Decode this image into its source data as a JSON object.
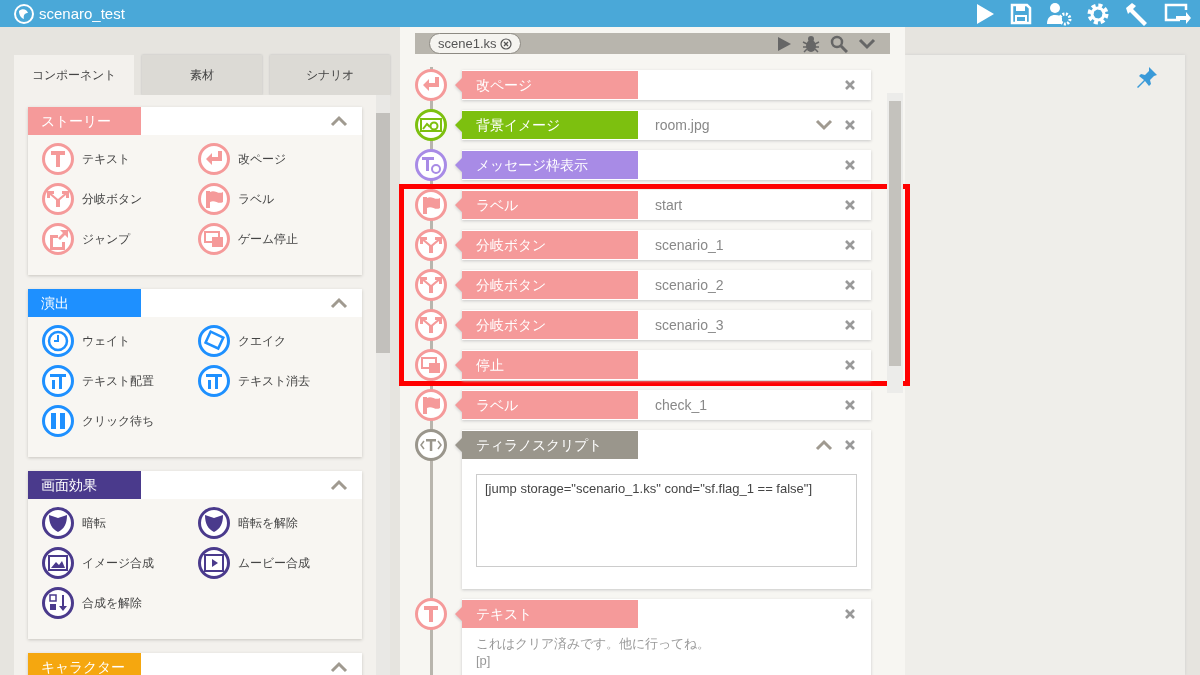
{
  "app": {
    "title": "scenaro_test"
  },
  "left_panel": {
    "tabs": [
      {
        "label": "コンポーネント",
        "selected": true
      },
      {
        "label": "素材",
        "selected": false
      },
      {
        "label": "シナリオ",
        "selected": false
      }
    ],
    "sections": [
      {
        "title": "ストーリー",
        "color": "#f59a9a",
        "expanded": true,
        "items": [
          {
            "label": "テキスト",
            "kind": "text"
          },
          {
            "label": "改ページ",
            "kind": "newpage"
          },
          {
            "label": "分岐ボタン",
            "kind": "branch"
          },
          {
            "label": "ラベル",
            "kind": "label"
          },
          {
            "label": "ジャンプ",
            "kind": "jump"
          },
          {
            "label": "ゲーム停止",
            "kind": "stop"
          }
        ]
      },
      {
        "title": "演出",
        "color": "#1e90ff",
        "expanded": true,
        "items": [
          {
            "label": "ウェイト",
            "kind": "wait"
          },
          {
            "label": "クエイク",
            "kind": "quake"
          },
          {
            "label": "テキスト配置",
            "kind": "layout"
          },
          {
            "label": "テキスト消去",
            "kind": "layout"
          },
          {
            "label": "クリック待ち",
            "kind": "click"
          }
        ]
      },
      {
        "title": "画面効果",
        "color": "#4a3a8c",
        "expanded": true,
        "items": [
          {
            "label": "暗転",
            "kind": "shield"
          },
          {
            "label": "暗転を解除",
            "kind": "shield"
          },
          {
            "label": "イメージ合成",
            "kind": "image"
          },
          {
            "label": "ムービー合成",
            "kind": "movie"
          },
          {
            "label": "合成を解除",
            "kind": "release"
          }
        ]
      },
      {
        "title": "キャラクター",
        "color": "#f5a70f",
        "expanded": true
      }
    ]
  },
  "editor": {
    "file_tab": "scene1.ks",
    "rows": [
      {
        "kind": "newpage",
        "label": "改ページ",
        "color": "#f59a9a",
        "highlighted": false
      },
      {
        "kind": "bg",
        "label": "背景イメージ",
        "color": "#7dc00f",
        "value": "room.jpg",
        "highlighted": false
      },
      {
        "kind": "message",
        "label": "メッセージ枠表示",
        "color": "#a88be6",
        "highlighted": false
      },
      {
        "kind": "label",
        "label": "ラベル",
        "color": "#f59a9a",
        "value": "start",
        "highlighted": true
      },
      {
        "kind": "branch",
        "label": "分岐ボタン",
        "color": "#f59a9a",
        "value": "scenario_1",
        "highlighted": true
      },
      {
        "kind": "branch",
        "label": "分岐ボタン",
        "color": "#f59a9a",
        "value": "scenario_2",
        "highlighted": true
      },
      {
        "kind": "branch",
        "label": "分岐ボタン",
        "color": "#f59a9a",
        "value": "scenario_3",
        "highlighted": true
      },
      {
        "kind": "stop",
        "label": "停止",
        "color": "#f59a9a",
        "highlighted": true
      },
      {
        "kind": "label",
        "label": "ラベル",
        "color": "#f59a9a",
        "value": "check_1",
        "highlighted": false
      },
      {
        "kind": "script",
        "label": "ティラノスクリプト",
        "color": "#9a968c",
        "expanded": true,
        "code": "[jump storage=\"scenario_1.ks\" cond=\"sf.flag_1 == false\"]",
        "highlighted": false
      },
      {
        "kind": "text",
        "label": "テキスト",
        "color": "#f59a9a",
        "text_lines": [
          "これはクリア済みです。他に行ってね。",
          "[p]"
        ],
        "highlighted": false
      }
    ]
  }
}
